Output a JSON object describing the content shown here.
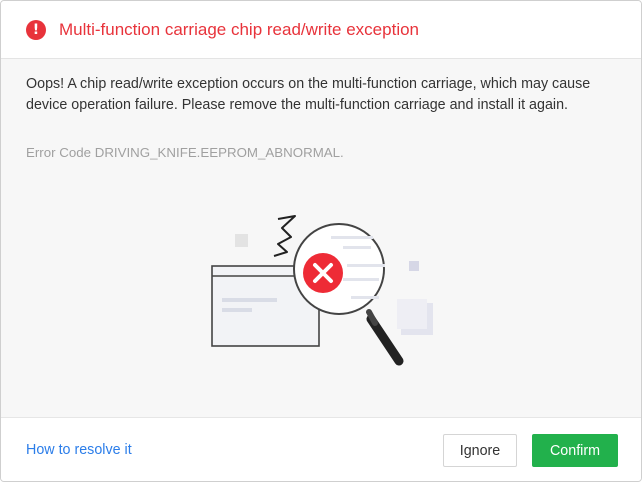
{
  "dialog": {
    "title": "Multi-function carriage chip read/write exception",
    "message": "Oops! A chip read/write exception occurs on the multi-function carriage, which may cause device operation failure. Please remove the multi-function carriage and install it again.",
    "error_code": "Error Code DRIVING_KNIFE.EEPROM_ABNORMAL.",
    "header_icon": "error-exclamation-icon",
    "header_icon_glyph": "!",
    "accent_color": "#e8333b"
  },
  "illustration": {
    "icon": "magnifier-error-icon"
  },
  "footer": {
    "resolve_link": "How to resolve it",
    "ignore_label": "Ignore",
    "confirm_label": "Confirm",
    "confirm_color": "#22b14c",
    "link_color": "#2b7de9"
  }
}
